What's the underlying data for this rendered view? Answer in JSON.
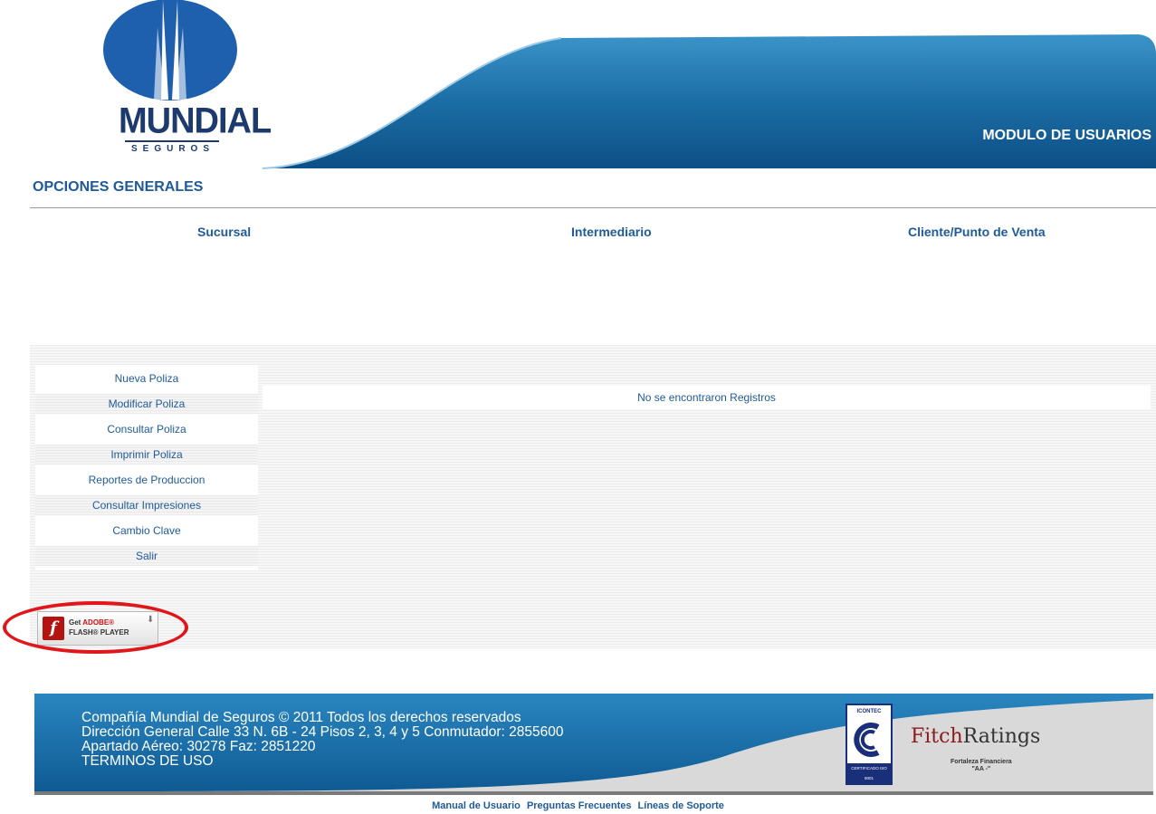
{
  "header": {
    "logo_word": "MUNDIAL",
    "logo_sub": "SEGUROS",
    "module_title": "MODULO DE USUARIOS"
  },
  "section_title": "OPCIONES GENERALES",
  "top_nav": [
    "Sucursal",
    "Intermediario",
    "Cliente/Punto de Venta"
  ],
  "side_menu": [
    "Nueva Poliza",
    "Modificar Poliza",
    "Consultar Poliza",
    "Imprimir Poliza",
    "Reportes de Produccion",
    "Consultar Impresiones",
    "Cambio Clave",
    "Salir"
  ],
  "results_message": "No se encontraron Registros",
  "flash_badge": {
    "get": "Get",
    "adobe": "ADOBE®",
    "product": "FLASH® PLAYER",
    "icon": "flash-logo-icon"
  },
  "footer": {
    "line1": "Compañía Mundial de Seguros © 2011 Todos los derechos reservados",
    "line2": "Dirección General Calle 33 N. 6B - 24 Pisos 2, 3, 4 y 5 Conmutador: 2855600",
    "line3": "Apartado Aéreo: 30278 Faz: 2851220",
    "terms": "TERMINOS DE USO",
    "icontec_top": "ICONTEC",
    "icontec_bottom": "CERTIFICADO ISO 9001",
    "fitch_a": "Fitch",
    "fitch_b": "Ratings",
    "fitch_sub1": "Fortaleza Financiera",
    "fitch_sub2": "\"AA -\""
  },
  "bottom_links": [
    "Manual de Usuario",
    "Preguntas Frecuentes",
    "Líneas de Soporte"
  ],
  "colors": {
    "brand_blue": "#1e6fa8",
    "link_blue": "#1f5a99",
    "highlight_red": "#e0161b"
  }
}
